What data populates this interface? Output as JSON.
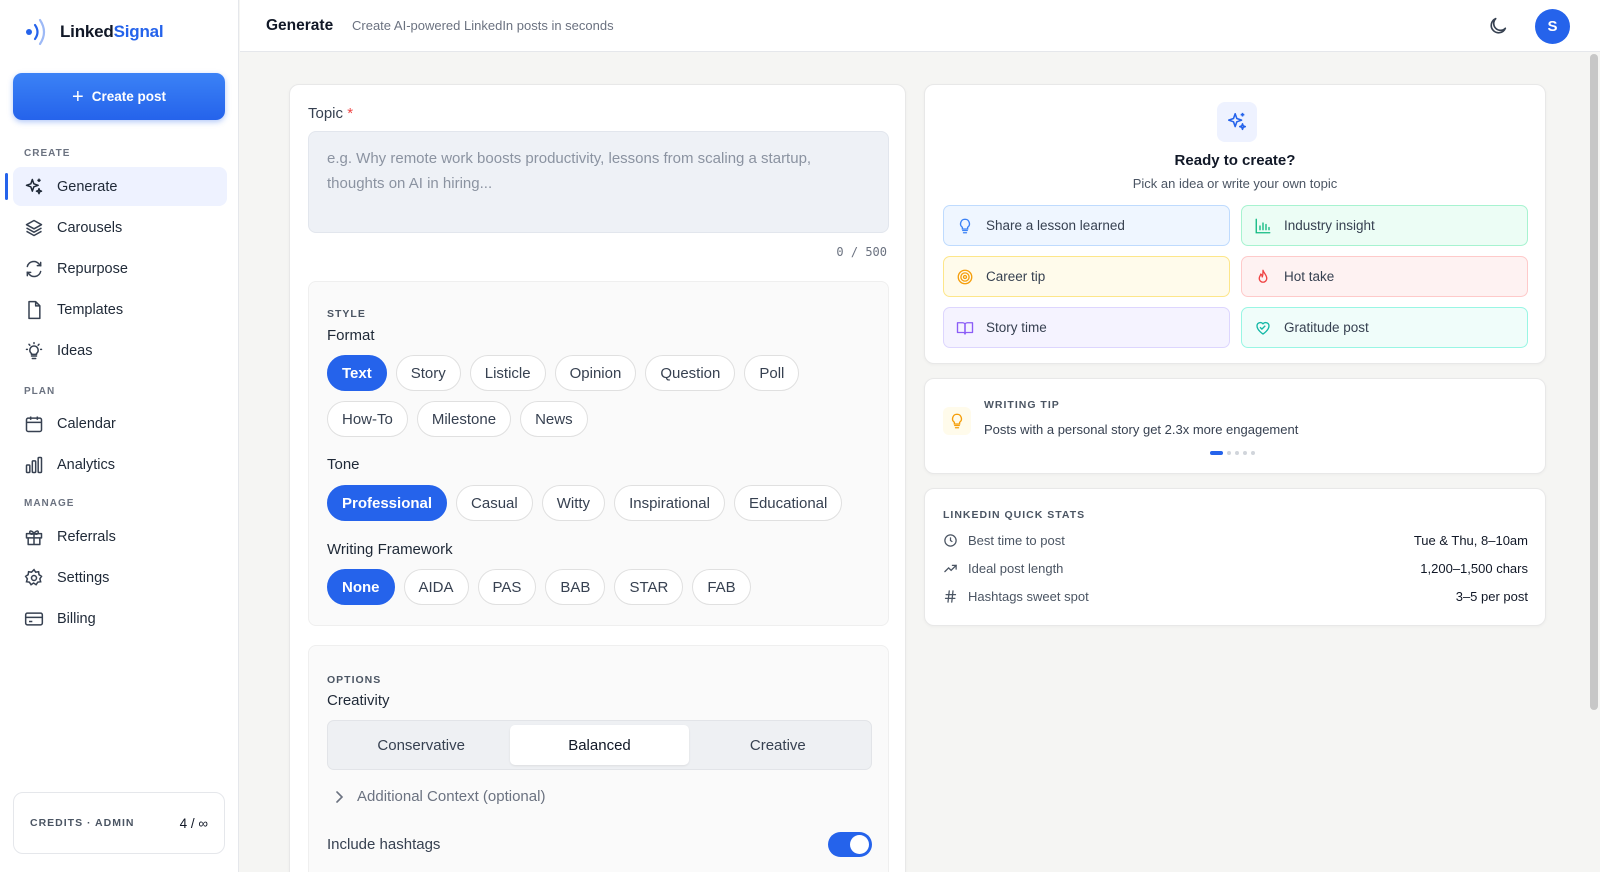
{
  "app": {
    "logo_main": "Linked",
    "logo_accent": "Signal"
  },
  "sidebar": {
    "create_button": "Create post",
    "sections": {
      "create": "CREATE",
      "plan": "PLAN",
      "manage": "MANAGE"
    },
    "items": [
      {
        "label": "Generate",
        "icon": "sparkles-icon"
      },
      {
        "label": "Carousels",
        "icon": "layers-icon"
      },
      {
        "label": "Repurpose",
        "icon": "refresh-icon"
      },
      {
        "label": "Templates",
        "icon": "file-icon"
      },
      {
        "label": "Ideas",
        "icon": "lightbulb-icon"
      },
      {
        "label": "Calendar",
        "icon": "calendar-icon"
      },
      {
        "label": "Analytics",
        "icon": "bar-chart-icon"
      },
      {
        "label": "Referrals",
        "icon": "gift-icon"
      },
      {
        "label": "Settings",
        "icon": "gear-icon"
      },
      {
        "label": "Billing",
        "icon": "credit-card-icon"
      }
    ],
    "credits": {
      "label": "CREDITS · ADMIN",
      "value": "4 / ∞"
    }
  },
  "header": {
    "title": "Generate",
    "subtitle": "Create AI-powered LinkedIn posts in seconds",
    "avatar_initial": "S"
  },
  "form": {
    "topic_label": "Topic",
    "required_mark": "*",
    "topic_placeholder": "e.g. Why remote work boosts productivity, lessons from scaling a startup, thoughts on AI in hiring...",
    "counter": "0 / 500",
    "style": {
      "section_label": "STYLE",
      "format_title": "Format",
      "formats": [
        "Text",
        "Story",
        "Listicle",
        "Opinion",
        "Question",
        "Poll",
        "How-To",
        "Milestone",
        "News"
      ],
      "format_selected": "Text",
      "tone_title": "Tone",
      "tones": [
        "Professional",
        "Casual",
        "Witty",
        "Inspirational",
        "Educational"
      ],
      "tone_selected": "Professional",
      "framework_title": "Writing Framework",
      "frameworks": [
        "None",
        "AIDA",
        "PAS",
        "BAB",
        "STAR",
        "FAB"
      ],
      "framework_selected": "None"
    },
    "options": {
      "section_label": "OPTIONS",
      "creativity_title": "Creativity",
      "creativity": [
        "Conservative",
        "Balanced",
        "Creative"
      ],
      "creativity_selected": "Balanced",
      "additional_context": "Additional Context (optional)",
      "hashtags_label": "Include hashtags",
      "hashtags_on": true
    }
  },
  "ready": {
    "title": "Ready to create?",
    "subtitle": "Pick an idea or write your own topic",
    "ideas": [
      {
        "label": "Share a lesson learned",
        "icon": "lightbulb-icon",
        "color": "#3b82f6"
      },
      {
        "label": "Industry insight",
        "icon": "bar-chart-icon",
        "color": "#10b981"
      },
      {
        "label": "Career tip",
        "icon": "target-icon",
        "color": "#f59e0b"
      },
      {
        "label": "Hot take",
        "icon": "flame-icon",
        "color": "#ef4444"
      },
      {
        "label": "Story time",
        "icon": "book-icon",
        "color": "#8b5cf6"
      },
      {
        "label": "Gratitude post",
        "icon": "heart-handshake-icon",
        "color": "#14b8a6"
      }
    ]
  },
  "tip": {
    "label": "WRITING TIP",
    "text": "Posts with a personal story get 2.3x more engagement"
  },
  "stats": {
    "label": "LINKEDIN QUICK STATS",
    "rows": [
      {
        "label": "Best time to post",
        "value": "Tue & Thu, 8–10am",
        "icon": "clock-icon"
      },
      {
        "label": "Ideal post length",
        "value": "1,200–1,500 chars",
        "icon": "trending-up-icon"
      },
      {
        "label": "Hashtags sweet spot",
        "value": "3–5 per post",
        "icon": "hash-icon"
      }
    ]
  },
  "colors": {
    "accent": "#2563eb"
  }
}
